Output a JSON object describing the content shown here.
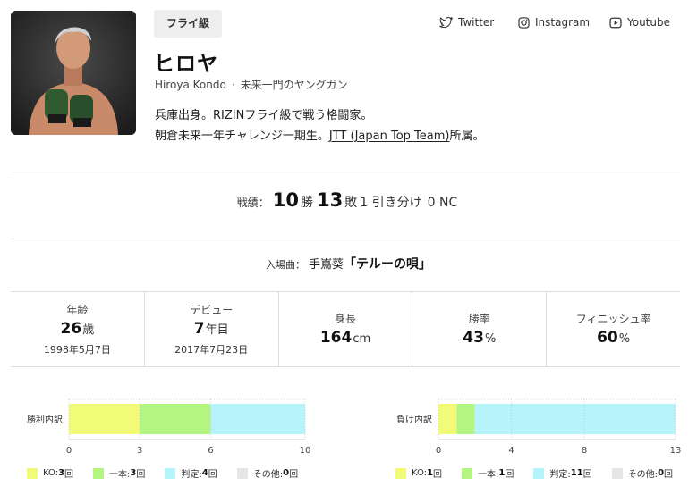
{
  "profile": {
    "weight_class": "フライ級",
    "name": "ヒロヤ",
    "romaji": "Hiroya Kondo",
    "tagline": "未来一門のヤングガン",
    "bio_line1": "兵庫出身。RIZINフライ級で戦う格闘家。",
    "bio_line2_pre": "朝倉未来一年チャレンジ一期生。",
    "bio_line2_link": "JTT (Japan Top Team)",
    "bio_line2_post": "所属。"
  },
  "social": {
    "twitter": "Twitter",
    "instagram": "Instagram",
    "youtube": "Youtube"
  },
  "record": {
    "label": "戦績：",
    "wins": "10",
    "wins_unit": "勝",
    "losses": "13",
    "losses_unit": "敗",
    "draws_text": "1 引き分け",
    "nc_text": "0 NC"
  },
  "entrance": {
    "label": "入場曲：",
    "artist": "手嶌葵",
    "song": "「テルーの唄」"
  },
  "stats": {
    "age": {
      "title": "年齢",
      "value": "26",
      "unit": "歳",
      "sub": "1998年5月7日"
    },
    "debut": {
      "title": "デビュー",
      "value": "7",
      "unit": "年目",
      "sub": "2017年7月23日"
    },
    "height": {
      "title": "身長",
      "value": "164",
      "unit": "cm"
    },
    "win_rate": {
      "title": "勝率",
      "value": "43",
      "unit": "%"
    },
    "finish_rate": {
      "title": "フィニッシュ率",
      "value": "60",
      "unit": "%"
    }
  },
  "colors": {
    "ko": "#f2fb78",
    "submission": "#b4f582",
    "decision": "#b5f4fb",
    "other": "#e6e6e6"
  },
  "chart_data": [
    {
      "type": "bar",
      "orientation": "horizontal-stacked",
      "ylabel": "勝利内訳",
      "categories": [
        "勝利内訳"
      ],
      "series": [
        {
          "name": "KO",
          "values": [
            3
          ]
        },
        {
          "name": "一本",
          "values": [
            3
          ]
        },
        {
          "name": "判定",
          "values": [
            4
          ]
        },
        {
          "name": "その他",
          "values": [
            0
          ]
        }
      ],
      "xlim": [
        0,
        10
      ],
      "xticks": [
        "0",
        "3",
        "6",
        "10"
      ],
      "legend": [
        {
          "label": "KO:",
          "count": "3",
          "unit": "回"
        },
        {
          "label": "一本:",
          "count": "3",
          "unit": "回"
        },
        {
          "label": "判定:",
          "count": "4",
          "unit": "回"
        },
        {
          "label": "その他:",
          "count": "0",
          "unit": "回"
        }
      ]
    },
    {
      "type": "bar",
      "orientation": "horizontal-stacked",
      "ylabel": "負け内訳",
      "categories": [
        "負け内訳"
      ],
      "series": [
        {
          "name": "KO",
          "values": [
            1
          ]
        },
        {
          "name": "一本",
          "values": [
            1
          ]
        },
        {
          "name": "判定",
          "values": [
            11
          ]
        },
        {
          "name": "その他",
          "values": [
            0
          ]
        }
      ],
      "xlim": [
        0,
        13
      ],
      "xticks": [
        "0",
        "4",
        "8",
        "13"
      ],
      "legend": [
        {
          "label": "KO:",
          "count": "1",
          "unit": "回"
        },
        {
          "label": "一本:",
          "count": "1",
          "unit": "回"
        },
        {
          "label": "判定:",
          "count": "11",
          "unit": "回"
        },
        {
          "label": "その他:",
          "count": "0",
          "unit": "回"
        }
      ]
    }
  ]
}
